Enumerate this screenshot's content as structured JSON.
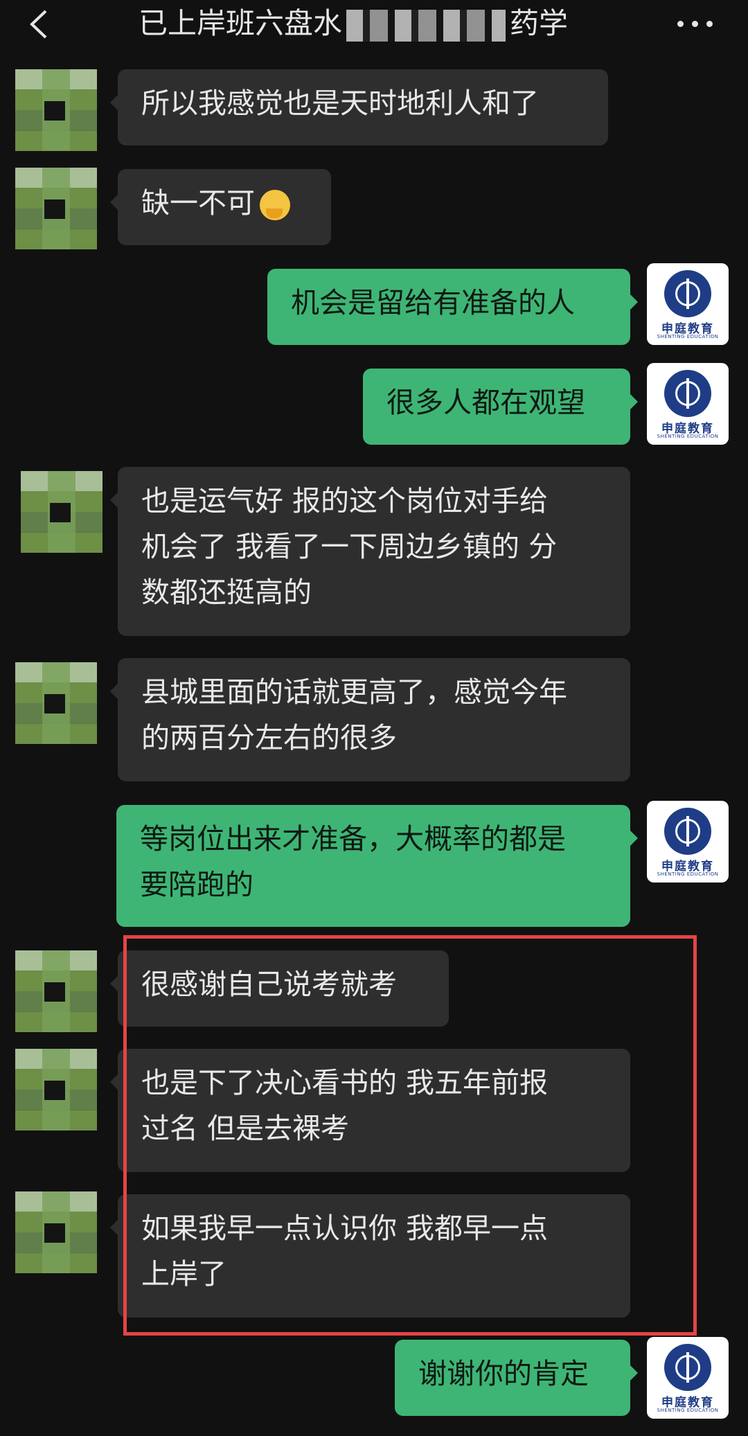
{
  "header": {
    "title_prefix": "已上岸班六盘水",
    "title_suffix": "药学",
    "back_icon": "chevron-left-icon",
    "more_icon": "more-dots-icon"
  },
  "messages": [
    {
      "side": "left",
      "lines": [
        "所以我感觉也是天时地利人和了"
      ]
    },
    {
      "side": "left",
      "lines": [
        "缺一不可"
      ],
      "emoji": "thinking-face-emoji"
    },
    {
      "side": "right",
      "lines": [
        "机会是留给有准备的人"
      ]
    },
    {
      "side": "right",
      "lines": [
        "很多人都在观望"
      ]
    },
    {
      "side": "left",
      "lines": [
        "也是运气好 报的这个岗位对手给",
        "机会了 我看了一下周边乡镇的 分",
        "数都还挺高的"
      ]
    },
    {
      "side": "left",
      "lines": [
        "县城里面的话就更高了，感觉今年",
        "的两百分左右的很多"
      ]
    },
    {
      "side": "right",
      "lines": [
        "等岗位出来才准备，大概率的都是",
        "要陪跑的"
      ]
    },
    {
      "side": "left",
      "lines": [
        "很感谢自己说考就考"
      ]
    },
    {
      "side": "left",
      "lines": [
        "也是下了决心看书的 我五年前报",
        "过名 但是去裸考"
      ]
    },
    {
      "side": "left",
      "lines": [
        "如果我早一点认识你 我都早一点",
        "上岸了"
      ]
    },
    {
      "side": "right",
      "lines": [
        "谢谢你的肯定"
      ]
    }
  ],
  "self_avatar": {
    "name_cn": "申庭教育",
    "name_en": "SHENTING EDUCATION"
  },
  "colors": {
    "background": "#111111",
    "incoming_bubble": "#2e2e2e",
    "outgoing_bubble": "#3eb575",
    "highlight": "#e54444"
  }
}
